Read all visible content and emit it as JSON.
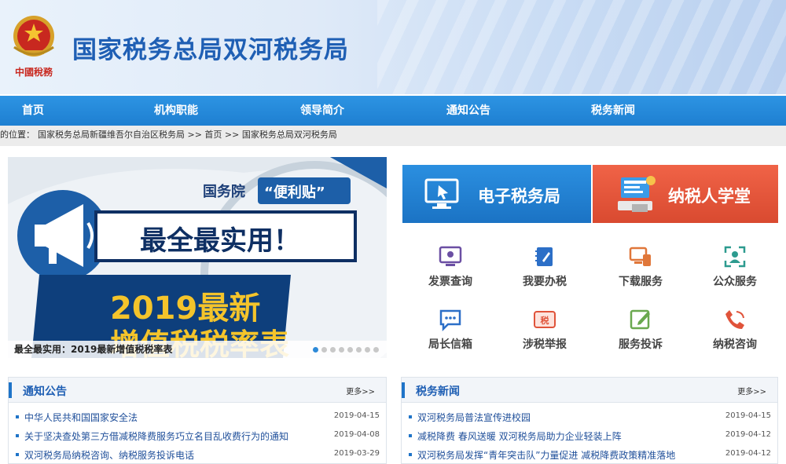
{
  "header": {
    "emblem_caption": "中國稅務",
    "title": "国家税务总局双河税务局"
  },
  "nav": {
    "items": [
      "首页",
      "机构职能",
      "领导简介",
      "通知公告",
      "税务新闻"
    ]
  },
  "breadcrumb": {
    "prefix": "的位置：",
    "path": "国家税务总局新疆维吾尔自治区税务局 >> 首页  >>  国家税务总局双河税务局"
  },
  "slider": {
    "tag": "国务院",
    "tag_highlight": "“便利贴”",
    "headline": "最全最实用！",
    "year_line": "2019最新",
    "cut_line": "增值税税率表",
    "caption": "最全最实用：2019最新增值税税率表",
    "dot_count": 8,
    "active_dot": 0
  },
  "banners": {
    "etax": "电子税务局",
    "school": "纳税人学堂"
  },
  "services": [
    {
      "label": "发票查询",
      "icon": "invoice-monitor-icon"
    },
    {
      "label": "我要办税",
      "icon": "notebook-pen-icon"
    },
    {
      "label": "下载服务",
      "icon": "download-devices-icon"
    },
    {
      "label": "公众服务",
      "icon": "public-user-icon"
    },
    {
      "label": "局长信箱",
      "icon": "chat-bubble-icon"
    },
    {
      "label": "涉税举报",
      "icon": "tax-report-icon"
    },
    {
      "label": "服务投诉",
      "icon": "edit-complaint-icon"
    },
    {
      "label": "纳税咨询",
      "icon": "phone-consult-icon"
    }
  ],
  "notice": {
    "title": "通知公告",
    "more": "更多>>",
    "items": [
      {
        "title": "中华人民共和国国家安全法",
        "date": "2019-04-15"
      },
      {
        "title": "关于坚决查处第三方借减税降费服务巧立名目乱收费行为的通知",
        "date": "2019-04-08"
      },
      {
        "title": "双河税务局纳税咨询、纳税服务投诉电话",
        "date": "2019-03-29"
      }
    ]
  },
  "news": {
    "title": "税务新闻",
    "more": "更多>>",
    "items": [
      {
        "title": "双河税务局普法宣传进校园",
        "date": "2019-04-15"
      },
      {
        "title": "减税降费 春风送暖 双河税务局助力企业轻装上阵",
        "date": "2019-04-12"
      },
      {
        "title": "双河税务局发挥“青年突击队”力量促进 减税降费政策精准落地",
        "date": "2019-04-12"
      }
    ]
  },
  "colors": {
    "nav_blue": "#1e7fd1",
    "title_blue": "#1f5fb4",
    "etax_blue": "#1b73c4",
    "school_red": "#e0533a"
  }
}
